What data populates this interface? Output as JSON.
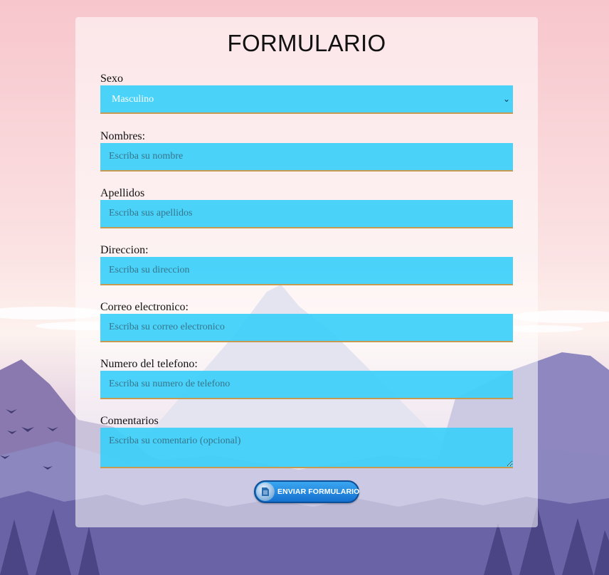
{
  "form": {
    "title": "FORMULARIO",
    "sexo": {
      "label": "Sexo",
      "selected": "Masculino",
      "options": [
        "Masculino"
      ]
    },
    "nombres": {
      "label": "Nombres:",
      "placeholder": "Escriba su nombre"
    },
    "apellidos": {
      "label": "Apellidos",
      "placeholder": "Escriba sus apellidos"
    },
    "direccion": {
      "label": "Direccion:",
      "placeholder": "Escriba su direccion"
    },
    "correo": {
      "label": "Correo electronico:",
      "placeholder": "Escriba su correo electronico"
    },
    "telefono": {
      "label": "Numero del telefono:",
      "placeholder": "Escriba su numero de telefono"
    },
    "comentarios": {
      "label": "Comentarios",
      "placeholder": "Escriba su comentario (opcional)"
    },
    "submit": {
      "label": "ENVIAR FORMULARIO",
      "icon": "document-icon"
    }
  },
  "icons": {
    "select": "chevron-down-icon"
  },
  "colors": {
    "field_bg": "#3ccffa",
    "field_border": "#c79a52",
    "button": "#1f86e0",
    "sky_top": "#f7c6cc",
    "mountains": "#6a64a6"
  }
}
